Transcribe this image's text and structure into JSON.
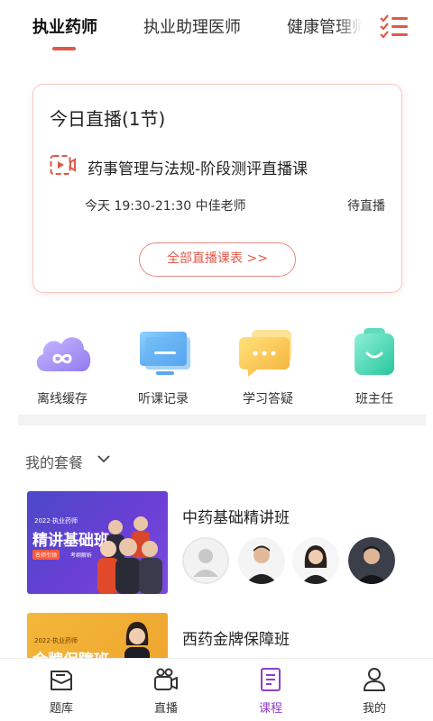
{
  "top_tabs": [
    {
      "label": "执业药师",
      "active": true
    },
    {
      "label": "执业助理医师",
      "active": false
    },
    {
      "label": "健康管理师",
      "active": false
    }
  ],
  "menu_icon": "list-menu-icon",
  "live_card": {
    "title": "今日直播(1节)",
    "course_name": "药事管理与法规-阶段测评直播课",
    "time_teacher": "今天 19:30-21:30 中佳老师",
    "status": "待直播",
    "all_schedule_label": "全部直播课表 >>"
  },
  "quick_actions": [
    {
      "label": "离线缓存",
      "icon": "cloud-icon"
    },
    {
      "label": "听课记录",
      "icon": "monitor-icon"
    },
    {
      "label": "学习答疑",
      "icon": "chat-bubble-icon"
    },
    {
      "label": "班主任",
      "icon": "head-teacher-icon"
    }
  ],
  "packages": {
    "heading": "我的套餐",
    "items": [
      {
        "title": "中药基础精讲班",
        "thumb_year": "2022·执业药师",
        "thumb_title": "精讲基础班",
        "thumb_tag": "名师引领",
        "thumb_tag2": "考纲解析",
        "teachers": [
          "teacher-placeholder",
          "teacher-1",
          "teacher-2",
          "teacher-3"
        ]
      },
      {
        "title": "西药金牌保障班",
        "thumb_year": "2022·执业药师",
        "thumb_title": "金牌保障班"
      }
    ]
  },
  "bottom_nav": [
    {
      "label": "题库",
      "icon": "question-bank-icon",
      "active": false
    },
    {
      "label": "直播",
      "icon": "live-camera-icon",
      "active": false
    },
    {
      "label": "课程",
      "icon": "course-book-icon",
      "active": true
    },
    {
      "label": "我的",
      "icon": "profile-icon",
      "active": false
    }
  ],
  "colors": {
    "accent": "#e0584a",
    "active_nav": "#8e3fc4"
  }
}
